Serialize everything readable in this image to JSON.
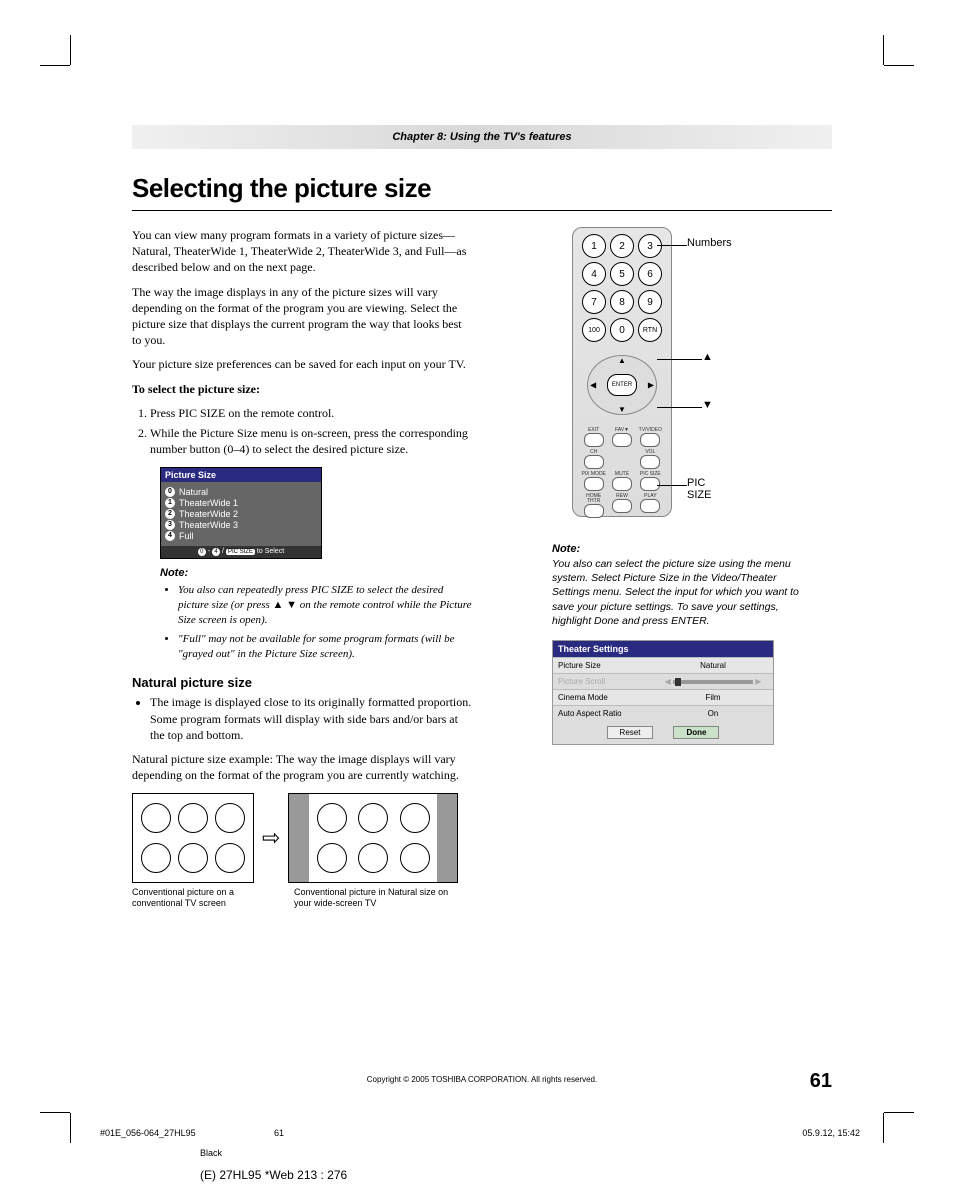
{
  "chapter": "Chapter 8: Using the TV's features",
  "title": "Selecting the picture size",
  "intro": [
    "You can view many program formats in a variety of picture sizes—Natural, TheaterWide 1, TheaterWide 2, TheaterWide 3, and Full—as described below and on the next page.",
    "The way the image displays in any of the picture sizes will vary depending on the format of the program you are viewing. Select the picture size that displays the current program the way that looks best to you.",
    "Your picture size preferences can be saved for each input on your TV."
  ],
  "how_to_label": "To select the picture size:",
  "steps": [
    "Press PIC SIZE on the remote control.",
    "While the Picture Size menu is on-screen, press the corresponding number button (0–4) to select the desired picture size."
  ],
  "osd": {
    "title": "Picture Size",
    "items": [
      {
        "n": "0",
        "label": "Natural"
      },
      {
        "n": "1",
        "label": "TheaterWide 1"
      },
      {
        "n": "2",
        "label": "TheaterWide 2"
      },
      {
        "n": "3",
        "label": "TheaterWide 3"
      },
      {
        "n": "4",
        "label": "Full"
      }
    ],
    "footer_prefix": "0",
    "footer_dash": "-",
    "footer_suffix": "4",
    "footer_slash": "/",
    "footer_badge": "PIC SIZE",
    "footer_end": "to Select"
  },
  "note_label": "Note:",
  "notes_left": [
    "You also can repeatedly press PIC SIZE to select the desired picture size (or press ▲ ▼ on the remote control while the Picture Size screen is open).",
    "\"Full\" may not be available for some program formats (will be \"grayed out\" in the Picture Size screen)."
  ],
  "natural": {
    "heading": "Natural picture size",
    "bullet": "The image is displayed close to its originally formatted proportion. Some program formats will display with side bars and/or bars at the top and bottom.",
    "example": "Natural picture size example: The way the image displays will vary depending on the format of the program you are currently watching.",
    "cap1": "Conventional picture on a conventional TV screen",
    "cap2": "Conventional picture in Natural size on your wide-screen TV"
  },
  "remote": {
    "numbers": [
      "1",
      "2",
      "3",
      "4",
      "5",
      "6",
      "7",
      "8",
      "9",
      "100",
      "0",
      "RTN"
    ],
    "enter": "ENTER",
    "callout_numbers": "Numbers",
    "callout_up": "▲",
    "callout_down": "▼",
    "callout_picsize": "PIC SIZE"
  },
  "note_right": "You also can select the picture size using the menu system. Select Picture Size in the Video/Theater Settings menu. Select the input for which you want to save your picture settings. To save your settings, highlight Done and press ENTER.",
  "settings": {
    "title": "Theater Settings",
    "rows": [
      {
        "l": "Picture Size",
        "r": "Natural"
      },
      {
        "l": "Picture Scroll",
        "r": "slider",
        "dim": true
      },
      {
        "l": "Cinema Mode",
        "r": "Film"
      },
      {
        "l": "Auto Aspect Ratio",
        "r": "On"
      }
    ],
    "reset": "Reset",
    "done": "Done"
  },
  "copyright": "Copyright © 2005 TOSHIBA CORPORATION. All rights reserved.",
  "page_number": "61",
  "print": {
    "file": "#01E_056-064_27HL95",
    "pg": "61",
    "date": "05.9.12, 15:42",
    "color": "Black"
  },
  "webref": "(E) 27HL95 *Web 213 : 276"
}
